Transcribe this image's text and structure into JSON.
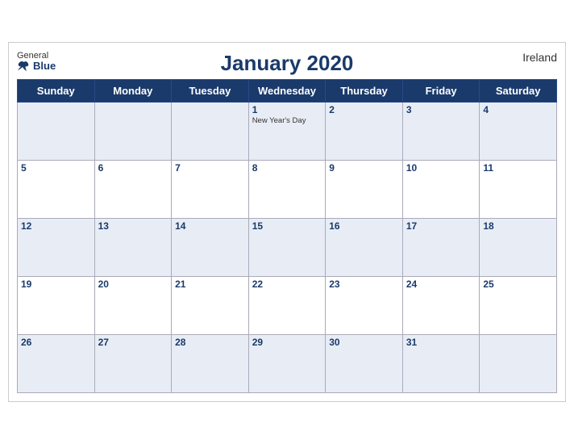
{
  "header": {
    "title": "January 2020",
    "country": "Ireland",
    "logo": {
      "general": "General",
      "blue": "Blue"
    }
  },
  "weekdays": [
    "Sunday",
    "Monday",
    "Tuesday",
    "Wednesday",
    "Thursday",
    "Friday",
    "Saturday"
  ],
  "weeks": [
    [
      {
        "day": "",
        "holiday": ""
      },
      {
        "day": "",
        "holiday": ""
      },
      {
        "day": "",
        "holiday": ""
      },
      {
        "day": "1",
        "holiday": "New Year's Day"
      },
      {
        "day": "2",
        "holiday": ""
      },
      {
        "day": "3",
        "holiday": ""
      },
      {
        "day": "4",
        "holiday": ""
      }
    ],
    [
      {
        "day": "5",
        "holiday": ""
      },
      {
        "day": "6",
        "holiday": ""
      },
      {
        "day": "7",
        "holiday": ""
      },
      {
        "day": "8",
        "holiday": ""
      },
      {
        "day": "9",
        "holiday": ""
      },
      {
        "day": "10",
        "holiday": ""
      },
      {
        "day": "11",
        "holiday": ""
      }
    ],
    [
      {
        "day": "12",
        "holiday": ""
      },
      {
        "day": "13",
        "holiday": ""
      },
      {
        "day": "14",
        "holiday": ""
      },
      {
        "day": "15",
        "holiday": ""
      },
      {
        "day": "16",
        "holiday": ""
      },
      {
        "day": "17",
        "holiday": ""
      },
      {
        "day": "18",
        "holiday": ""
      }
    ],
    [
      {
        "day": "19",
        "holiday": ""
      },
      {
        "day": "20",
        "holiday": ""
      },
      {
        "day": "21",
        "holiday": ""
      },
      {
        "day": "22",
        "holiday": ""
      },
      {
        "day": "23",
        "holiday": ""
      },
      {
        "day": "24",
        "holiday": ""
      },
      {
        "day": "25",
        "holiday": ""
      }
    ],
    [
      {
        "day": "26",
        "holiday": ""
      },
      {
        "day": "27",
        "holiday": ""
      },
      {
        "day": "28",
        "holiday": ""
      },
      {
        "day": "29",
        "holiday": ""
      },
      {
        "day": "30",
        "holiday": ""
      },
      {
        "day": "31",
        "holiday": ""
      },
      {
        "day": "",
        "holiday": ""
      }
    ]
  ],
  "colors": {
    "header_bg": "#1a3a6b",
    "header_text": "#ffffff",
    "row_odd": "#e8edf5",
    "row_even": "#ffffff",
    "day_number": "#1a3a6b",
    "title": "#1a3a6b"
  }
}
